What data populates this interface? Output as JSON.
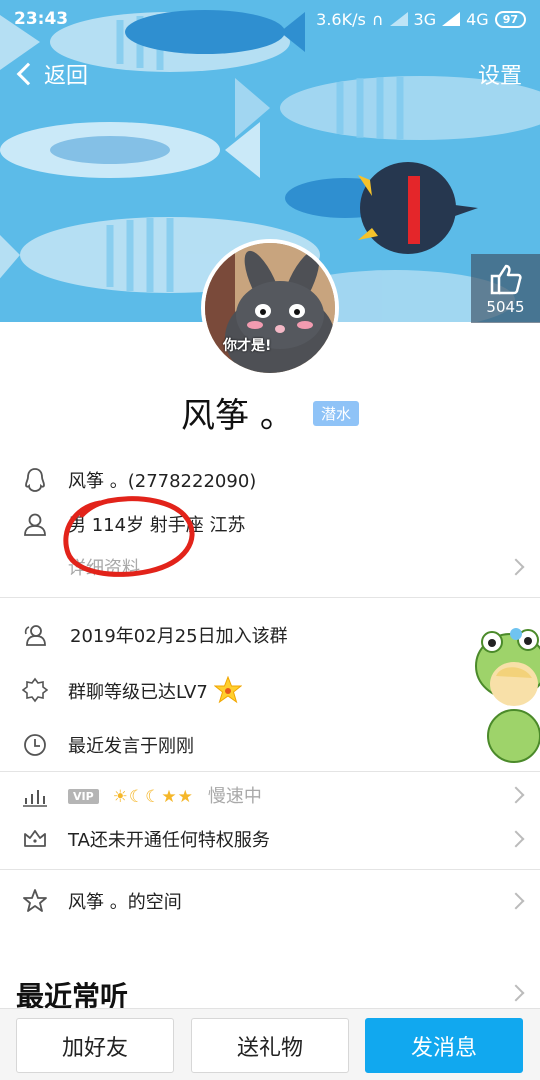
{
  "status_bar": {
    "time": "23:43",
    "net_speed": "3.6K/s",
    "net_3g": "3G",
    "net_4g": "4G",
    "battery": "97"
  },
  "nav": {
    "back_label": "返回",
    "settings_label": "设置"
  },
  "like": {
    "count": "5045"
  },
  "profile": {
    "avatar_caption": "你才是!",
    "name": "风筝 。",
    "tag": "潜水"
  },
  "basic_info": {
    "qq_line": "风筝 。(2778222090)",
    "detail_line": "男 114岁 射手座 江苏",
    "more_label": "详细资料"
  },
  "group_info": {
    "joined": "2019年02月25日加入该群",
    "level": "群聊等级已达LV7",
    "last_speak": "最近发言于刚刚"
  },
  "privileges": {
    "vip_badge": "VIP",
    "level_icons": "☀☾☾★★",
    "speed": "慢速中",
    "service": "TA还未开通任何特权服务"
  },
  "space": {
    "label": "风筝 。的空间"
  },
  "recent": {
    "title": "最近常听"
  },
  "actions": {
    "add_friend": "加好友",
    "send_gift": "送礼物",
    "send_message": "发消息"
  },
  "colors": {
    "banner": "#5cbbe8",
    "primary_button": "#11a8ef",
    "tag": "#8fc3f7",
    "annotation": "#e2231a"
  }
}
